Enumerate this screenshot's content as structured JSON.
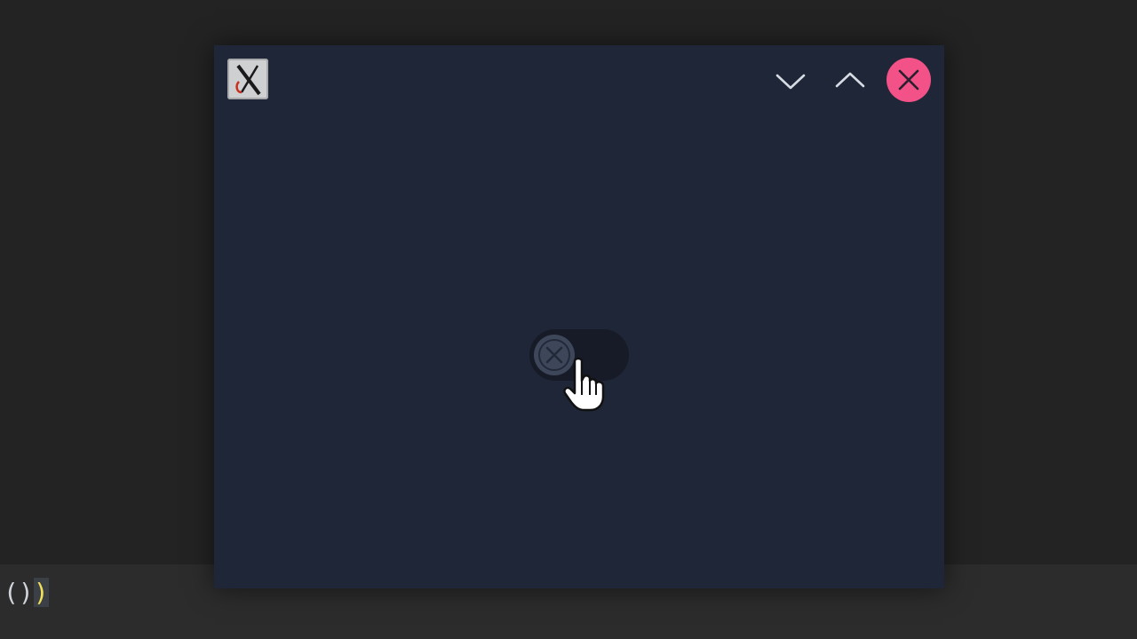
{
  "window": {
    "logo_icon": "x-window-logo-icon",
    "controls": {
      "minimize_icon": "chevron-down-icon",
      "maximize_icon": "chevron-up-icon",
      "close_icon": "close-icon",
      "close_color": "#f25287"
    },
    "background_color": "#1f2637"
  },
  "toggle": {
    "state": "off",
    "knob_icon": "close-icon"
  },
  "terminal": {
    "prompt_text": "()",
    "cursor_char": ")"
  },
  "pointer": {
    "icon": "hand-pointer-icon"
  }
}
